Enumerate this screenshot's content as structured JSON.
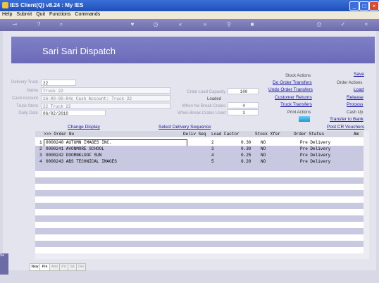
{
  "window": {
    "title": "IES Client(Q) v8.24 : My IES",
    "min": "_",
    "max": "□",
    "close": "×"
  },
  "menu": [
    "Help",
    "Submit",
    "Quit",
    "Functions",
    "Commands"
  ],
  "toolbar_icons": [
    "key-icon",
    "help-icon",
    "search-icon",
    "heart-icon",
    "clock-icon",
    "rewind-icon",
    "fast-forward-icon",
    "filter-icon",
    "stop-icon",
    "print-icon",
    "check-icon",
    "close-icon"
  ],
  "page": {
    "title": "Sari Sari Dispatch"
  },
  "form": {
    "delivery_truck": {
      "label": "Delivery Truck",
      "value": "22"
    },
    "name": {
      "label": "Name",
      "value": "Truck 22"
    },
    "cash_account": {
      "label": "Cash Account",
      "value": "16-00-00-84c Cash Account: Truck 22"
    },
    "truck_store": {
      "label": "Truck Store",
      "value": "22 Truck 22"
    },
    "daily_date": {
      "label": "Daily Date",
      "value": "06/02/2010"
    },
    "crate_capacity": {
      "label": "Crate Load Capacity",
      "value": "100"
    },
    "loaded": {
      "label": "Loaded",
      "value": ""
    },
    "no_break": {
      "label": "When No Break Crates",
      "value": "4"
    },
    "break_used": {
      "label": "When Break Crates Used",
      "value": "3"
    }
  },
  "actions": {
    "stock_actions": "Stock Actions",
    "do_order_transfers": "Do Order Transfers",
    "undo_order_transfers": "Undo Order Transfers",
    "customer_returns": "Customer Returns",
    "truck_transfers": "Truck Transfers",
    "print_actions": "Print Actions",
    "save": "Save",
    "order_actions": "Order Actions",
    "load": "Load",
    "release": "Release",
    "process": "Process",
    "cash_up": "Cash Up",
    "transfer_to_bank": "Transfer to Bank",
    "post_cr_vouchers": "Post CR Vouchers",
    "change_display": "Change Display",
    "select_delivery_sequence": "Select Delivery Sequence"
  },
  "table": {
    "headers": {
      "order_no": ">>> Order No",
      "deliv_seq": "Deliv Seq",
      "load_factor": "Load Factor",
      "stock_xfer": "Stock Xfer",
      "order_status": "Order Status",
      "am": "Am"
    },
    "rows": [
      {
        "n": "1",
        "order": "0000240 AUTUMN IMAGES INC.",
        "seq": "2",
        "factor": "0.30",
        "xfer": "NO",
        "status": "Pre Delivery"
      },
      {
        "n": "2",
        "order": "0000241 AVONMORE SCHOOL",
        "seq": "3",
        "factor": "0.30",
        "xfer": "NO",
        "status": "Pre Delivery"
      },
      {
        "n": "3",
        "order": "0000242 DOORNKLOOF SUN",
        "seq": "4",
        "factor": "0.25",
        "xfer": "NO",
        "status": "Pre Delivery"
      },
      {
        "n": "4",
        "order": "0000243 ABS TECHNICAL IMAGES",
        "seq": "5",
        "factor": "0.20",
        "xfer": "NO",
        "status": "Pre Delivery"
      }
    ]
  },
  "bottom_tabs": [
    "New",
    "Pre",
    "Amt",
    "Prt",
    "Sd",
    "Del"
  ],
  "side_tab": "Se"
}
